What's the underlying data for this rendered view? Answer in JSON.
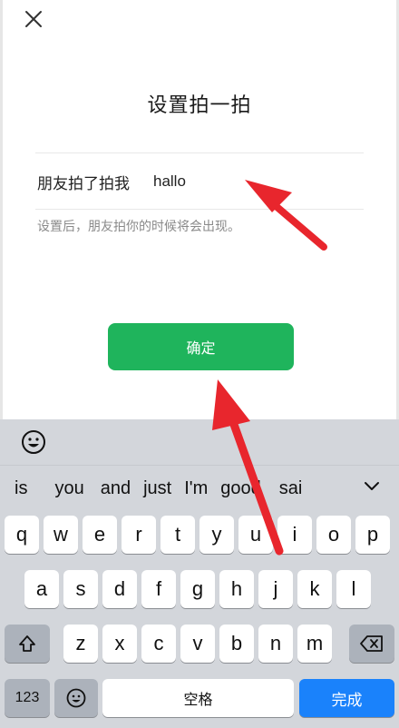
{
  "header": {
    "close_icon": "close-icon"
  },
  "page": {
    "title": "设置拍一拍",
    "field_label": "朋友拍了拍我",
    "field_value": "hallo",
    "hint": "设置后，朋友拍你的时候将会出现。",
    "confirm_label": "确定",
    "confirm_color": "#1fb45c"
  },
  "keyboard": {
    "suggestions": [
      "is",
      "you",
      "and",
      "just",
      "I'm",
      "good",
      "sai"
    ],
    "row1": [
      "q",
      "w",
      "e",
      "r",
      "t",
      "y",
      "u",
      "i",
      "o",
      "p"
    ],
    "row2": [
      "a",
      "s",
      "d",
      "f",
      "g",
      "h",
      "j",
      "k",
      "l"
    ],
    "row3": [
      "z",
      "x",
      "c",
      "v",
      "b",
      "n",
      "m"
    ],
    "numbers_label": "123",
    "space_label": "空格",
    "done_label": "完成",
    "accent_color": "#1a82fb"
  },
  "annotation": {
    "arrow_color": "#e8262d"
  }
}
